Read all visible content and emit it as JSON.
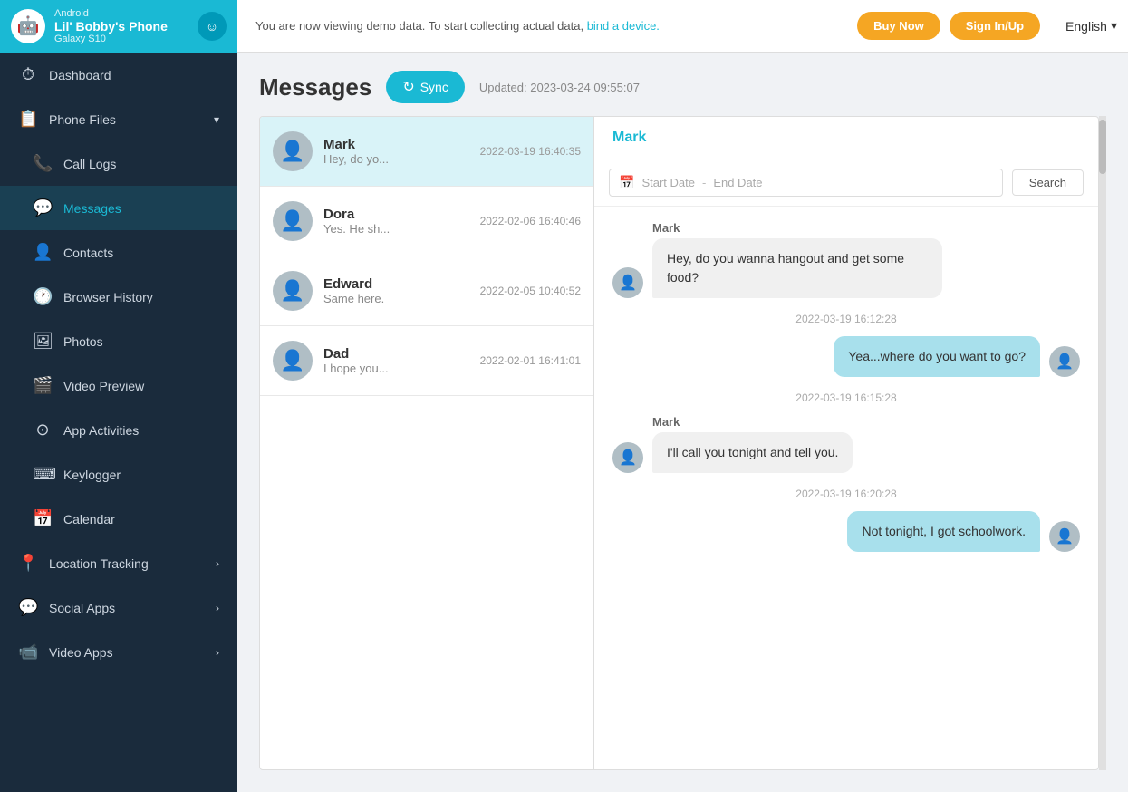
{
  "topbar": {
    "android_label": "Android",
    "device_name": "Lil' Bobby's Phone",
    "device_model": "Galaxy S10",
    "notice_text": "You are now viewing demo data. To start collecting actual data,",
    "notice_link": "bind a device.",
    "btn_buy_now": "Buy Now",
    "btn_sign_in": "Sign In/Up",
    "lang": "English"
  },
  "sidebar": {
    "items": [
      {
        "id": "dashboard",
        "label": "Dashboard",
        "icon": "⏱",
        "active": false,
        "expand": false
      },
      {
        "id": "phone-files",
        "label": "Phone Files",
        "icon": "📋",
        "active": false,
        "expand": true
      },
      {
        "id": "call-logs",
        "label": "Call Logs",
        "icon": "📞",
        "active": false,
        "expand": false
      },
      {
        "id": "messages",
        "label": "Messages",
        "icon": "💬",
        "active": true,
        "expand": false
      },
      {
        "id": "contacts",
        "label": "Contacts",
        "icon": "👤",
        "active": false,
        "expand": false
      },
      {
        "id": "browser-history",
        "label": "Browser History",
        "icon": "🕐",
        "active": false,
        "expand": false
      },
      {
        "id": "photos",
        "label": "Photos",
        "icon": "🖼",
        "active": false,
        "expand": false
      },
      {
        "id": "video-preview",
        "label": "Video Preview",
        "icon": "🎬",
        "active": false,
        "expand": false
      },
      {
        "id": "app-activities",
        "label": "App Activities",
        "icon": "⊙",
        "active": false,
        "expand": false
      },
      {
        "id": "keylogger",
        "label": "Keylogger",
        "icon": "⌨",
        "active": false,
        "expand": false
      },
      {
        "id": "calendar",
        "label": "Calendar",
        "icon": "📅",
        "active": false,
        "expand": false
      },
      {
        "id": "location-tracking",
        "label": "Location Tracking",
        "icon": "📍",
        "active": false,
        "expand": true
      },
      {
        "id": "social-apps",
        "label": "Social Apps",
        "icon": "💬",
        "active": false,
        "expand": true
      },
      {
        "id": "video-apps",
        "label": "Video Apps",
        "icon": "📹",
        "active": false,
        "expand": true
      }
    ]
  },
  "page": {
    "title": "Messages",
    "sync_label": "Sync",
    "updated_text": "Updated: 2023-03-24 09:55:07"
  },
  "conversations": [
    {
      "name": "Mark",
      "preview": "Hey, do yo...",
      "time": "2022-03-19 16:40:35",
      "selected": true
    },
    {
      "name": "Dora",
      "preview": "Yes. He sh...",
      "time": "2022-02-06 16:40:46",
      "selected": false
    },
    {
      "name": "Edward",
      "preview": "Same here.",
      "time": "2022-02-05 10:40:52",
      "selected": false
    },
    {
      "name": "Dad",
      "preview": "I hope you...",
      "time": "2022-02-01 16:41:01",
      "selected": false
    }
  ],
  "chat": {
    "contact_name": "Mark",
    "search_placeholder_start": "Start Date",
    "search_placeholder_end": "End Date",
    "search_btn_label": "Search",
    "messages": [
      {
        "id": 1,
        "sender": "Mark",
        "type": "received",
        "text": "Hey, do you wanna hangout and get some food?",
        "timestamp": "2022-03-19 16:12:28"
      },
      {
        "id": 2,
        "sender": "me",
        "type": "sent",
        "text": "Yea...where do you want to go?",
        "timestamp": "2022-03-19 16:15:28"
      },
      {
        "id": 3,
        "sender": "Mark",
        "type": "received",
        "text": "I'll call you tonight and tell you.",
        "timestamp": "2022-03-19 16:20:28"
      },
      {
        "id": 4,
        "sender": "me",
        "type": "sent",
        "text": "Not tonight, I got schoolwork.",
        "timestamp": ""
      }
    ]
  }
}
